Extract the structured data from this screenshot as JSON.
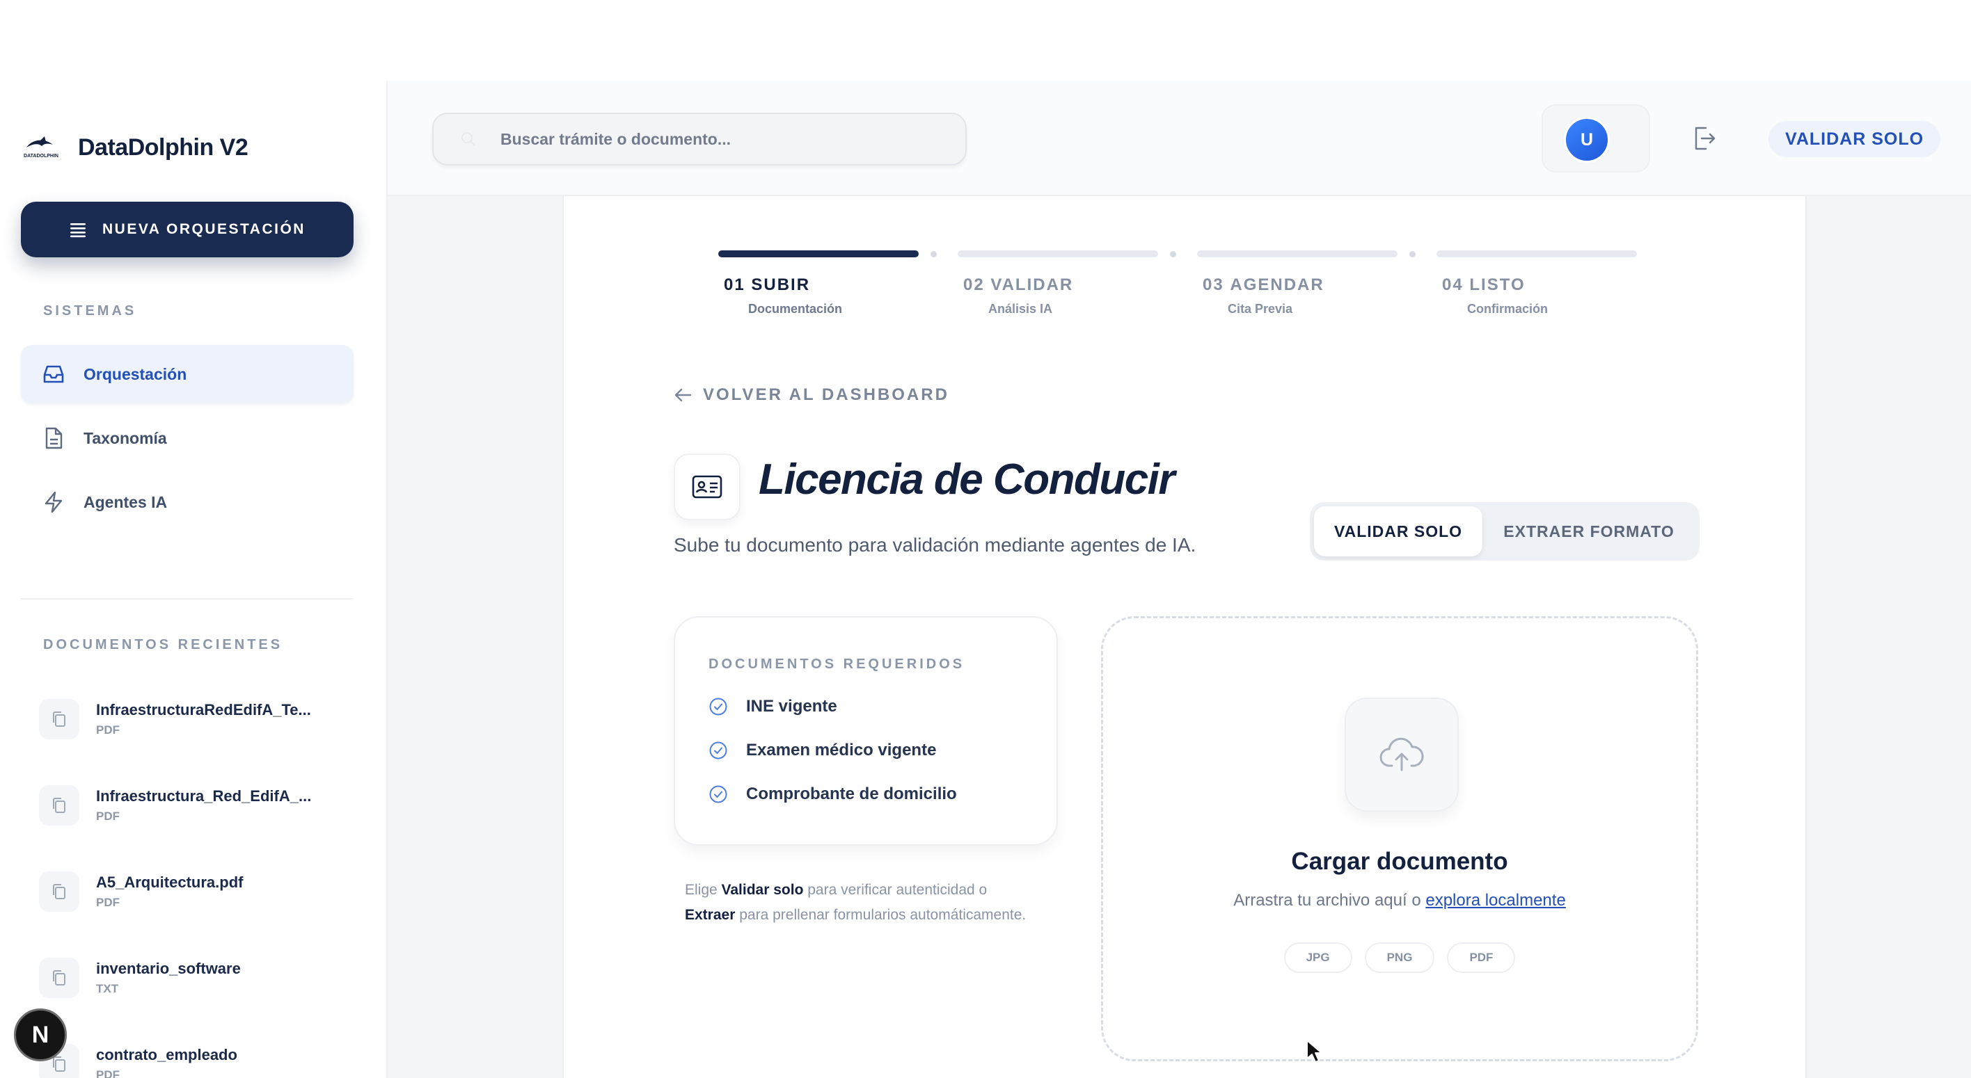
{
  "app": {
    "name": "DataDolphin V2",
    "logo_text": "DATADOLPHIN"
  },
  "sidebar": {
    "new_button": "NUEVA ORQUESTACIÓN",
    "systems_label": "SISTEMAS",
    "nav": [
      {
        "label": "Orquestación",
        "icon": "inbox-icon",
        "active": true
      },
      {
        "label": "Taxonomía",
        "icon": "document-icon",
        "active": false
      },
      {
        "label": "Agentes IA",
        "icon": "lightning-icon",
        "active": false
      }
    ],
    "recent_label": "DOCUMENTOS RECIENTES",
    "recent_docs": [
      {
        "name": "InfraestructuraRedEdifA_Te...",
        "type": "PDF"
      },
      {
        "name": "Infraestructura_Red_EdifA_...",
        "type": "PDF"
      },
      {
        "name": "A5_Arquitectura.pdf",
        "type": "PDF"
      },
      {
        "name": "inventario_software",
        "type": "TXT"
      },
      {
        "name": "contrato_empleado",
        "type": "PDF"
      }
    ]
  },
  "header": {
    "search_placeholder": "Buscar trámite o documento...",
    "avatar_initial": "U",
    "mode_button": "VALIDAR SOLO"
  },
  "steps": [
    {
      "num": "01",
      "label": "SUBIR",
      "sub": "Documentación",
      "active": true
    },
    {
      "num": "02",
      "label": "VALIDAR",
      "sub": "Análisis IA",
      "active": false
    },
    {
      "num": "03",
      "label": "AGENDAR",
      "sub": "Cita Previa",
      "active": false
    },
    {
      "num": "04",
      "label": "LISTO",
      "sub": "Confirmación",
      "active": false
    }
  ],
  "main": {
    "back_label": "VOLVER AL DASHBOARD",
    "title": "Licencia de Conducir",
    "subtitle": "Sube tu documento para validación mediante agentes de IA.",
    "toggle": {
      "option1": "VALIDAR SOLO",
      "option2": "EXTRAER FORMATO",
      "selected": "VALIDAR SOLO"
    },
    "requirements": {
      "title": "DOCUMENTOS REQUERIDOS",
      "items": [
        "INE vigente",
        "Examen médico vigente",
        "Comprobante de domicilio"
      ]
    },
    "hint": {
      "part1": "Elige ",
      "bold1": "Validar solo",
      "part2": " para verificar autenticidad o ",
      "bold2": "Extraer",
      "part3": " para prellenar formularios automáticamente."
    },
    "upload": {
      "title": "Cargar documento",
      "text": "Arrastra tu archivo aquí o ",
      "link": "explora localmente",
      "formats": [
        "JPG",
        "PNG",
        "PDF"
      ]
    }
  },
  "misc": {
    "dev_badge": "N"
  },
  "colors": {
    "primary": "#1a2b52",
    "accent": "#2350b7",
    "muted": "#8b97a9"
  }
}
